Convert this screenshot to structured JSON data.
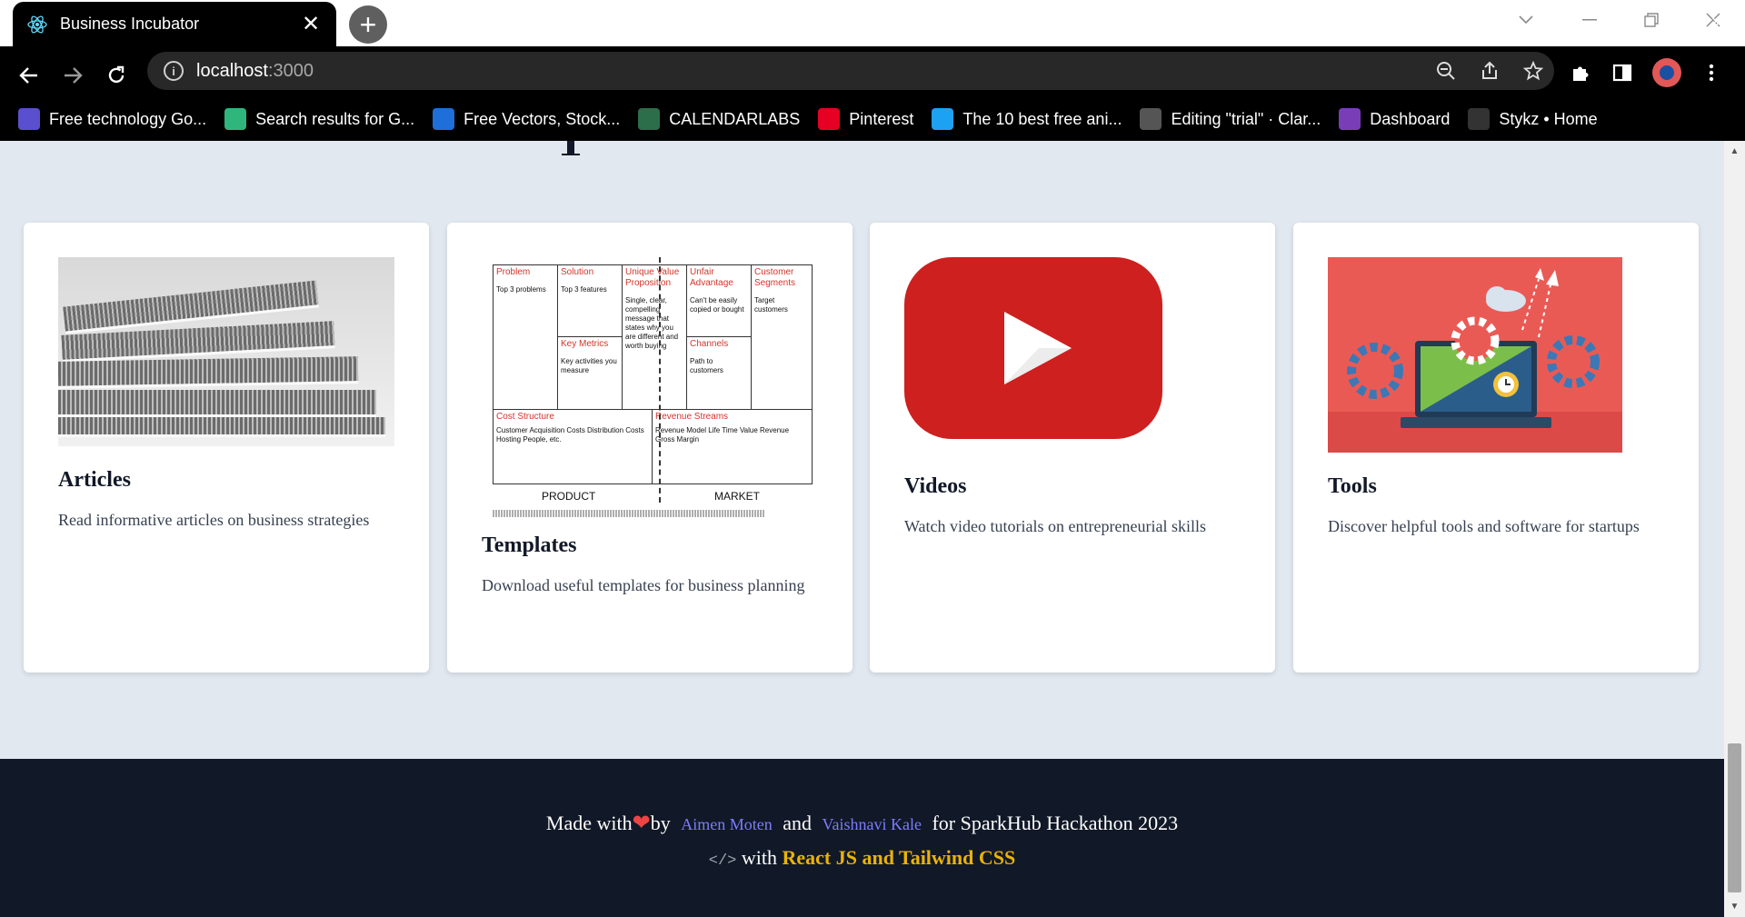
{
  "browser": {
    "tab_title": "Business Incubator",
    "tab_close": "✕",
    "new_tab": "+",
    "url_host": "localhost",
    "url_port": ":3000",
    "bookmarks": [
      {
        "label": "Free technology Go...",
        "icon": "technology-icon",
        "color": "#5a4fcf"
      },
      {
        "label": "Search results for G...",
        "icon": "vuetify-icon",
        "color": "#2fb67c"
      },
      {
        "label": "Free Vectors, Stock...",
        "icon": "vecteezy-icon",
        "color": "#1e6fd9"
      },
      {
        "label": "CALENDARLABS",
        "icon": "calendarlabs-icon",
        "color": "#2c6e49"
      },
      {
        "label": "Pinterest",
        "icon": "pinterest-icon",
        "color": "#e60023"
      },
      {
        "label": "The 10 best free ani...",
        "icon": "bird-icon",
        "color": "#1da1f2"
      },
      {
        "label": "Editing \"trial\" · Clar...",
        "icon": "cloud-icon",
        "color": "#555555"
      },
      {
        "label": "Dashboard",
        "icon": "dashboard-icon",
        "color": "#7a3db8"
      },
      {
        "label": "Stykz • Home",
        "icon": "stykz-icon",
        "color": "#333333"
      }
    ],
    "bookmarks_more": "»"
  },
  "cards": [
    {
      "title": "Articles",
      "description": "Read informative articles on business strategies",
      "image": "newspaper-image"
    },
    {
      "title": "Templates",
      "description": "Download useful templates for business planning",
      "image": "lean-canvas-image"
    },
    {
      "title": "Videos",
      "description": "Watch video tutorials on entrepreneurial skills",
      "image": "youtube-logo-image"
    },
    {
      "title": "Tools",
      "description": "Discover helpful tools and software for startups",
      "image": "tools-laptop-image"
    }
  ],
  "lean_canvas": {
    "problem": {
      "title": "Problem",
      "text": "Top 3 problems"
    },
    "solution": {
      "title": "Solution",
      "text": "Top 3 features"
    },
    "uvp": {
      "title": "Unique Value Proposition",
      "text": "Single, clear, compelling message that states why you are different and worth buying"
    },
    "unfair": {
      "title": "Unfair Advantage",
      "text": "Can't be easily copied or bought"
    },
    "segments": {
      "title": "Customer Segments",
      "text": "Target customers"
    },
    "metrics": {
      "title": "Key Metrics",
      "text": "Key activities you measure"
    },
    "channels": {
      "title": "Channels",
      "text": "Path to customers"
    },
    "cost": {
      "title": "Cost Structure",
      "text": "Customer Acquisition Costs Distribution Costs Hosting People, etc."
    },
    "revenue": {
      "title": "Revenue Streams",
      "text": "Revenue Model Life Time Value Revenue Gross Margin"
    },
    "product": "PRODUCT",
    "market": "MARKET"
  },
  "footer": {
    "made_with": "Made with",
    "by": "by",
    "author1": "Aimen Moten",
    "and": "and",
    "author2": "Vaishnavi Kale",
    "for_text": "for SparkHub Hackathon 2023",
    "code_symbol": "</>",
    "with": "with",
    "tech": "React JS and Tailwind CSS"
  }
}
